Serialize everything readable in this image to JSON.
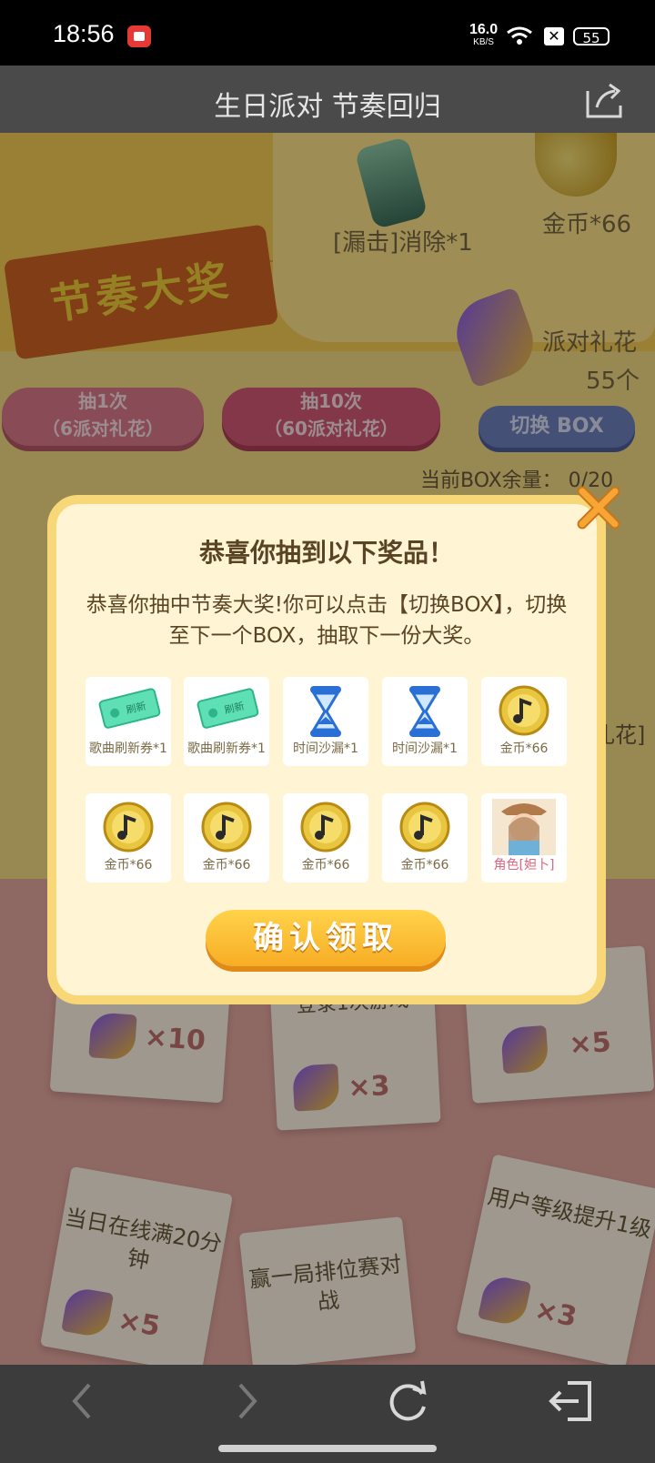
{
  "status_bar": {
    "time": "18:56",
    "net_speed_value": "16.0",
    "net_speed_unit": "KB/S",
    "battery": "55"
  },
  "header": {
    "title": "生日派对 节奏回归"
  },
  "background": {
    "banner_label": "节奏大奖",
    "prize_miss": "[漏击]消除*1",
    "prize_coin": "金币*66",
    "party_flower_label": "派对礼花",
    "party_flower_count": "55个",
    "draw1_line1": "抽1次",
    "draw1_line2": "（6派对礼花）",
    "draw10_line1": "抽10次",
    "draw10_line2": "（60派对礼花）",
    "switch_box": "切换 BOX",
    "box_remaining": "当前BOX余量：  0/20",
    "right_fragment": "礼花]",
    "task_login": "登录1次游戏",
    "task_online": "当日在线满20分钟",
    "task_rank": "赢一局排位赛对战",
    "task_level": "用户等级提升1级",
    "mult_left": "×10",
    "mult_login": "×3",
    "mult_right": "×5",
    "mult_online": "×5",
    "mult_level": "×3"
  },
  "dialog": {
    "title": "恭喜你抽到以下奖品！",
    "message": "恭喜你抽中节奏大奖!你可以点击【切换BOX】，切换至下一个BOX，抽取下一份大奖。",
    "rewards": [
      {
        "label": "歌曲刷新券*1",
        "icon": "ticket-icon"
      },
      {
        "label": "歌曲刷新券*1",
        "icon": "ticket-icon"
      },
      {
        "label": "时间沙漏*1",
        "icon": "hourglass-icon"
      },
      {
        "label": "时间沙漏*1",
        "icon": "hourglass-icon"
      },
      {
        "label": "金币*66",
        "icon": "coin-icon"
      },
      {
        "label": "金币*66",
        "icon": "coin-icon"
      },
      {
        "label": "金币*66",
        "icon": "coin-icon"
      },
      {
        "label": "金币*66",
        "icon": "coin-icon"
      },
      {
        "label": "金币*66",
        "icon": "coin-icon"
      },
      {
        "label": "角色[妲卜]",
        "icon": "character-avatar-icon"
      }
    ],
    "ticket_text": "刷新",
    "confirm": "确认领取"
  },
  "colors": {
    "title_bar": "#4a4a4a",
    "dialog_bg": "#fff4d3",
    "dialog_border": "#f7d777",
    "confirm_button": "#f7ad25",
    "close_icon": "#f39a2a"
  }
}
